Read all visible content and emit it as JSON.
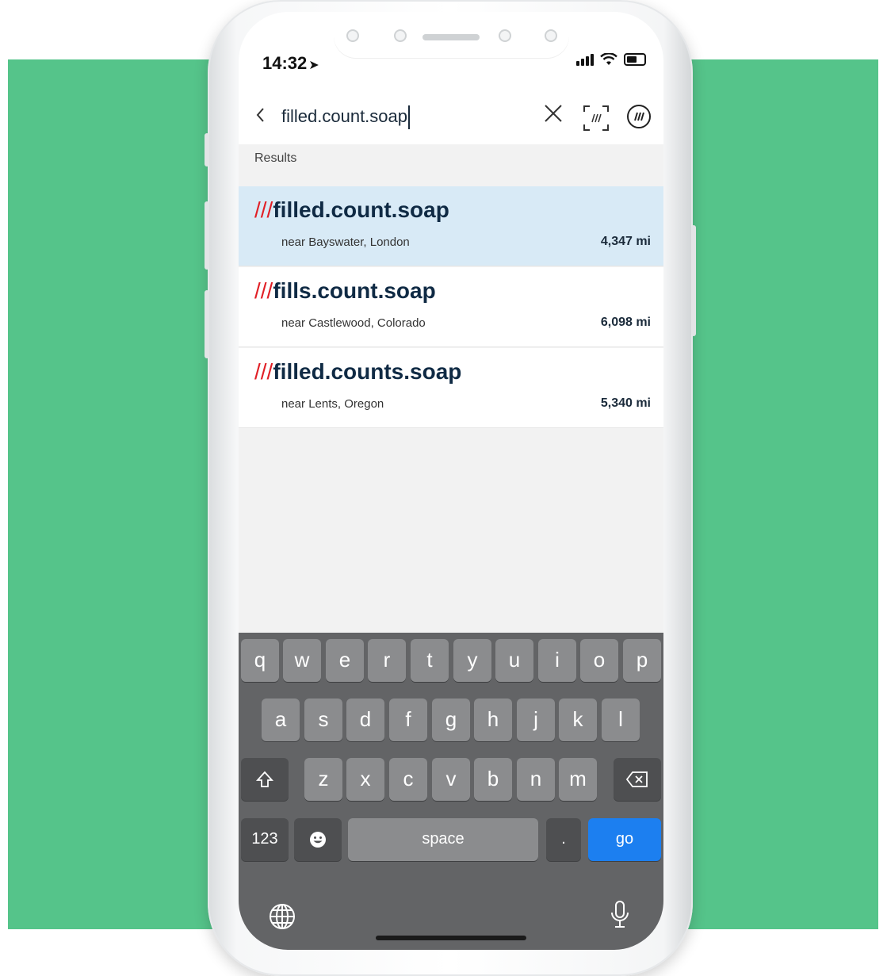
{
  "status_bar": {
    "time": "14:32"
  },
  "search": {
    "value": "filled.count.soap"
  },
  "results_label": "Results",
  "results": [
    {
      "slashes": "///",
      "words": "filled.count.soap",
      "near": "near Bayswater, London",
      "distance": "4,347 mi",
      "selected": true
    },
    {
      "slashes": "///",
      "words": "fills.count.soap",
      "near": "near Castlewood, Colorado",
      "distance": "6,098 mi",
      "selected": false
    },
    {
      "slashes": "///",
      "words": "filled.counts.soap",
      "near": "near Lents, Oregon",
      "distance": "5,340 mi",
      "selected": false
    }
  ],
  "keyboard": {
    "row1": [
      "q",
      "w",
      "e",
      "r",
      "t",
      "y",
      "u",
      "i",
      "o",
      "p"
    ],
    "row2": [
      "a",
      "s",
      "d",
      "f",
      "g",
      "h",
      "j",
      "k",
      "l"
    ],
    "row3": [
      "z",
      "x",
      "c",
      "v",
      "b",
      "n",
      "m"
    ],
    "numbers_label": "123",
    "space_label": "space",
    "period_label": ".",
    "go_label": "go"
  },
  "colors": {
    "background": "#55c48a",
    "selected_row": "#d8eaf6",
    "slash_red": "#e11f26",
    "go_blue": "#1c7ff0",
    "keyboard_bg": "#636466"
  }
}
